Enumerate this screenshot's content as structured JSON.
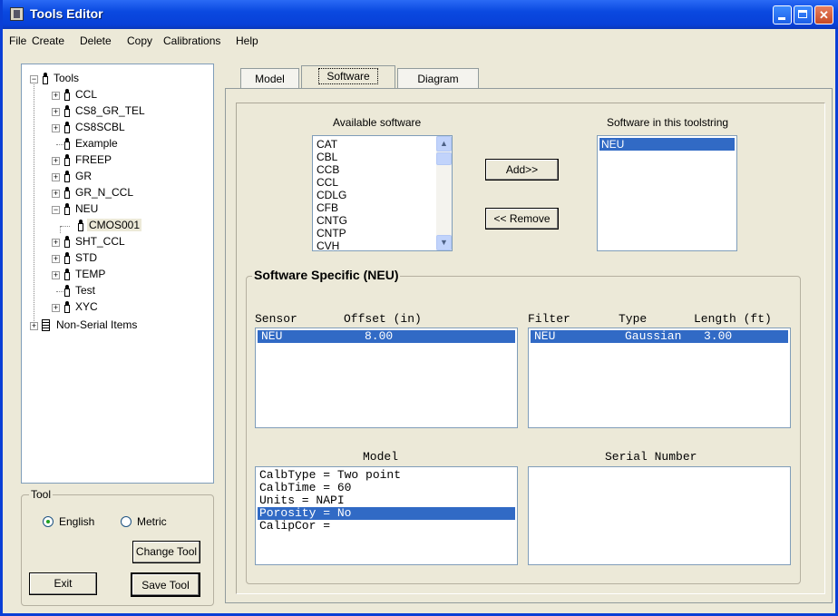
{
  "window": {
    "title": "Tools Editor",
    "buttons": [
      "minimize",
      "maximize",
      "close"
    ]
  },
  "menu": [
    {
      "label": "File"
    },
    {
      "label": "Create"
    },
    {
      "label": "Delete"
    },
    {
      "label": "Copy"
    },
    {
      "label": "Calibrations"
    },
    {
      "label": "Help"
    }
  ],
  "tree": {
    "root": "Tools",
    "items": [
      "CCL",
      "CS8_GR_TEL",
      "CS8SCBL",
      "Example",
      "FREEP",
      "GR",
      "GR_N_CCL",
      "NEU",
      "CMOS001",
      "SHT_CCL",
      "STD",
      "TEMP",
      "Test",
      "XYC"
    ],
    "non_serial": "Non-Serial Items"
  },
  "tool_group": {
    "title": "Tool",
    "english": "English",
    "metric": "Metric",
    "selected_unit": "English",
    "change_tool": "Change Tool",
    "exit": "Exit",
    "save_tool": "Save Tool"
  },
  "tabs": [
    {
      "label": "Model"
    },
    {
      "label": "Software"
    },
    {
      "label": "Diagram"
    }
  ],
  "active_tab": "Software",
  "software": {
    "available_title": "Available software",
    "available": [
      "CAT",
      "CBL",
      "CCB",
      "CCL",
      "CDLG",
      "CFB",
      "CNTG",
      "CNTP",
      "CVH"
    ],
    "add_button": "Add>>",
    "remove_button": "<< Remove",
    "toolstring_title": "Software in this toolstring",
    "toolstring": [
      "NEU"
    ]
  },
  "specific": {
    "title": "Software Specific (NEU)",
    "sensor_header": "Sensor",
    "offset_header": "Offset (in)",
    "sensors": [
      {
        "name": "NEU",
        "offset": "8.00"
      }
    ],
    "filter_header": "Filter",
    "type_header": "Type",
    "length_header": "Length (ft)",
    "filters": [
      {
        "name": "NEU",
        "type": "Gaussian",
        "length": "3.00"
      }
    ],
    "model_header": "Model",
    "model_lines": [
      "CalbType = Two point",
      "CalbTime = 60",
      "Units = NAPI",
      "Porosity = No",
      "CalipCor ="
    ],
    "model_selected": "Porosity = No",
    "serial_header": "Serial Number",
    "serial_lines": []
  },
  "colors": {
    "titlebar": "#0a49e0",
    "selection": "#316ac5",
    "face": "#ece9d8"
  }
}
